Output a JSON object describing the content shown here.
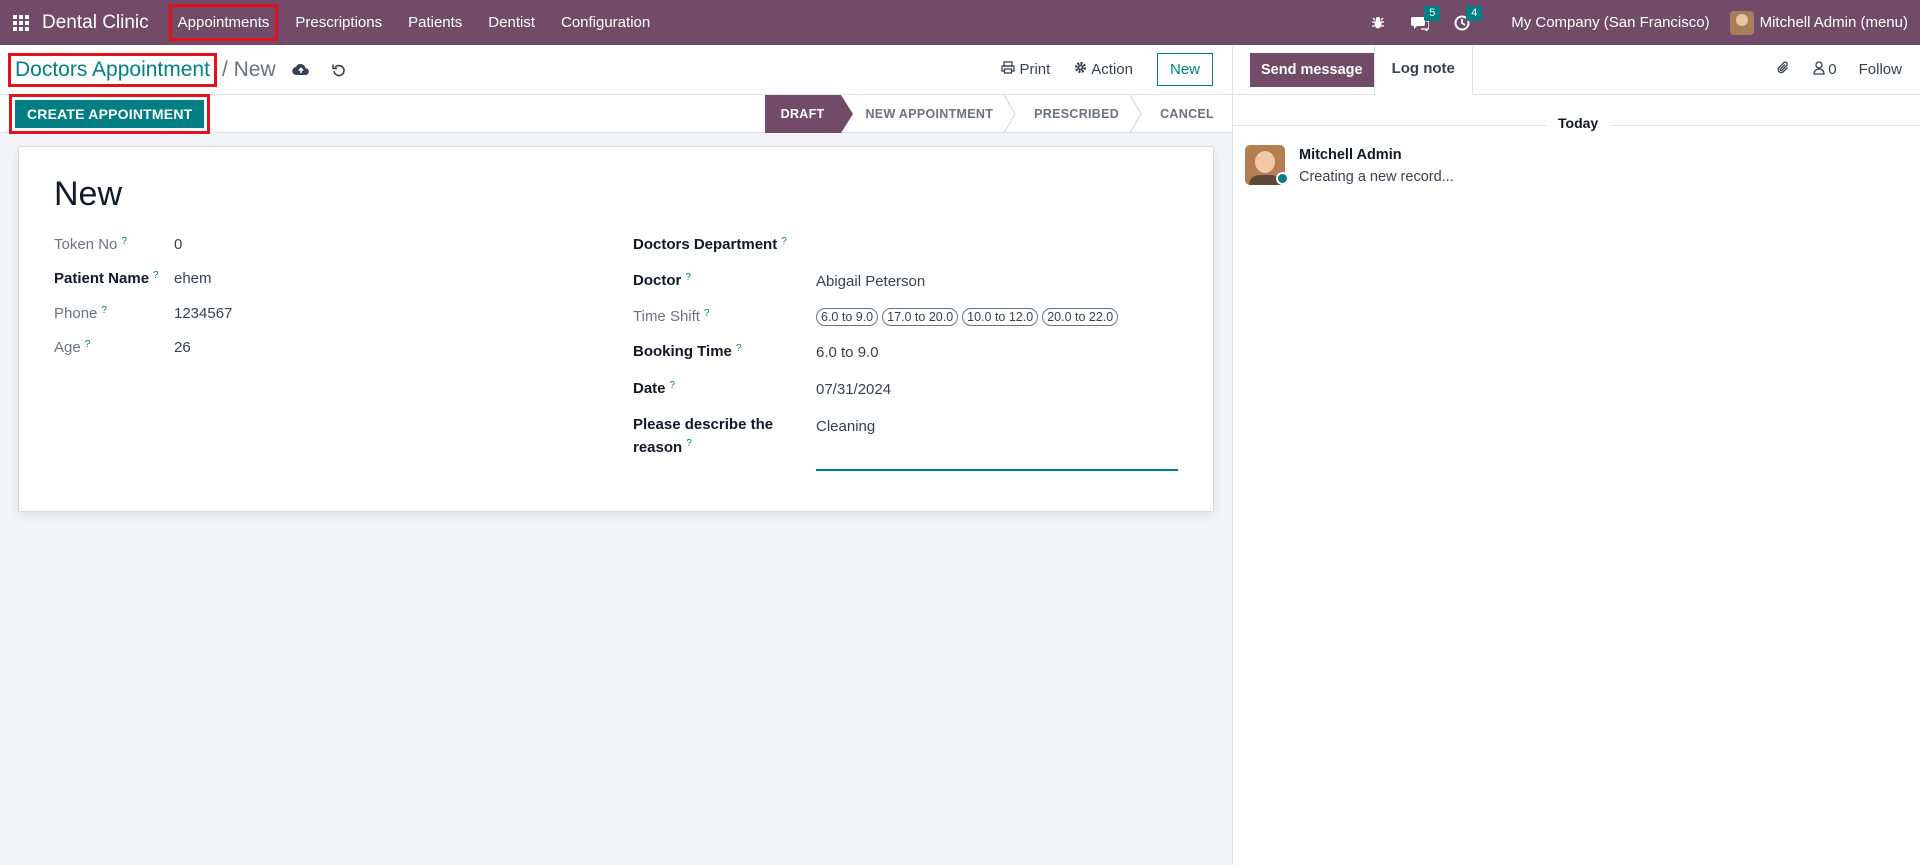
{
  "navbar": {
    "brand": "Dental Clinic",
    "menu": [
      "Appointments",
      "Prescriptions",
      "Patients",
      "Dentist",
      "Configuration"
    ],
    "messages_count": "5",
    "activities_count": "4",
    "company": "My Company (San Francisco)",
    "user": "Mitchell Admin (menu)"
  },
  "control": {
    "breadcrumb_parent": "Doctors Appointment",
    "breadcrumb_current": "/ New",
    "print_label": "Print",
    "action_label": "Action",
    "new_label": "New"
  },
  "statusrow": {
    "create_button": "CREATE APPOINTMENT",
    "stages": [
      "DRAFT",
      "NEW APPOINTMENT",
      "PRESCRIBED",
      "CANCEL"
    ],
    "active_stage": "DRAFT"
  },
  "form": {
    "title": "New",
    "left": {
      "token_label": "Token No",
      "token_value": "0",
      "patient_label": "Patient Name",
      "patient_value": "ehem",
      "phone_label": "Phone",
      "phone_value": "1234567",
      "age_label": "Age",
      "age_value": "26"
    },
    "right": {
      "department_label": "Doctors Department",
      "doctor_label": "Doctor",
      "doctor_value": "Abigail Peterson",
      "shift_label": "Time Shift",
      "shift_tags": [
        "6.0 to 9.0",
        "17.0 to 20.0",
        "10.0 to 12.0",
        "20.0 to 22.0"
      ],
      "booking_label": "Booking Time",
      "booking_value": "6.0 to 9.0",
      "date_label": "Date",
      "date_value": "07/31/2024",
      "reason_label_1": "Please describe the",
      "reason_label_2": "reason",
      "reason_value": "Cleaning"
    },
    "help_mark": "?"
  },
  "chatter": {
    "send_message": "Send message",
    "log_note": "Log note",
    "followers_count": "0",
    "follow_label": "Follow",
    "today_label": "Today",
    "message_author": "Mitchell Admin",
    "message_text": "Creating a new record..."
  },
  "colors": {
    "brand_purple": "#714b67",
    "accent_teal": "#017e84",
    "highlight_red": "#e0121d"
  }
}
